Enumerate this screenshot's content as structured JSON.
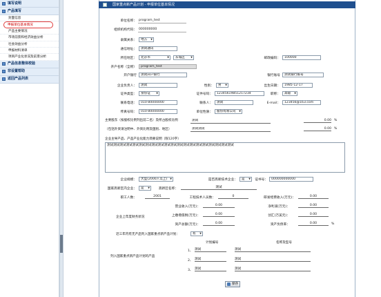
{
  "sidebar": {
    "sections": [
      {
        "label": "填写说明"
      },
      {
        "label": "产品填写",
        "items": [
          "封面信息",
          "申报单位基本情况",
          "产品主要情况",
          "市场前景和经济效益分析",
          "社会效益分析",
          "申报材料清单",
          "项目产业化状况及前景分析"
        ]
      },
      {
        "label": "产品信息整体校验"
      },
      {
        "label": "非设置帮助"
      },
      {
        "label": "返回产品列表"
      }
    ]
  },
  "window": {
    "title": "国家重点新产品计划 - 申报单位基本情况"
  },
  "form": {
    "unit_name": {
      "label": "单位名称：",
      "value": "program_test"
    },
    "org_code": {
      "label": "组织机构代码：",
      "value": "000000000"
    },
    "affiliation": {
      "label": "隶属关系：",
      "value": "地方"
    },
    "address": {
      "label": "通信地址：",
      "value": "测试通讯"
    },
    "region": {
      "label": "所在地区：",
      "province": "北京市",
      "district": "东城区"
    },
    "postcode": {
      "label": "邮政编码：",
      "value": "100000"
    },
    "owner_name": {
      "label": "开户名称（全称）",
      "value": "program_test"
    },
    "bank": {
      "label": "开户银行",
      "value": "测试开户银行"
    },
    "account": {
      "label": "银行账号",
      "value": "测试银行账号"
    },
    "legal_rep": {
      "label": "企业负责人：",
      "value": "测试"
    },
    "gender": {
      "label": "性别：",
      "value": "男"
    },
    "birth": {
      "label": "出生日期：",
      "value": "1985-12-17"
    },
    "cert_type": {
      "label": "证件类型：",
      "value": "身份证"
    },
    "cert_no": {
      "label": "证件号码：",
      "value": "12345619851217234"
    },
    "title": {
      "label": "职称：",
      "value": "高级"
    },
    "phone": {
      "label": "联系电话：",
      "value": "010-80000000"
    },
    "contact": {
      "label": "联系人：",
      "value": "测试"
    },
    "email": {
      "label": "E-mail：",
      "value": "123456@163.com"
    },
    "fax": {
      "label": "传真号码：",
      "value": "010-80000000"
    },
    "unit_nature": {
      "label": "单位性质：",
      "value": "股份有限公司"
    },
    "shareholders": {
      "label1": "主要股东（按股权比例列出前二名）及所占股权比例",
      "label2": "（包括外资请注明中、外资比例及国别、地区）",
      "rows": [
        {
          "name": "测试",
          "pct": "0.00"
        },
        {
          "name": "测试测试",
          "pct": "0.00"
        }
      ],
      "unit": "%"
    },
    "intro_label": "企业主导产品、产品产业化能力简要说明（限120字）",
    "intro_value": "测试测试测试测试测试测试测试测试测试测试测试测试测试测试测试测试测试测试测试测试",
    "scale": {
      "label": "企业规模：",
      "value": "大型(2000人以上)"
    },
    "hightech": {
      "label": "是否高新技术企业：",
      "value": "是"
    },
    "cert_no2": {
      "label": "证书号：",
      "value": "000000000000"
    },
    "national_ind": {
      "label": "国家高新区内企业：",
      "value": "是"
    },
    "zone_name": {
      "label": "高新区名称：",
      "value": "测试"
    },
    "staff": {
      "label": "职工人数：",
      "value": "2001"
    },
    "tech_staff": {
      "label": "工程技术人员数：",
      "value": "0"
    },
    "rd_ratio": {
      "label": "研发经费收入(万元)：",
      "value": "0.00"
    },
    "finance_label": "企业上年度财务状况",
    "revenue": {
      "label": "营业收入(万元)：",
      "value": "0.00"
    },
    "net_profit": {
      "label": "净利润(万元)：",
      "value": "0.00"
    },
    "tax": {
      "label": "上缴增值税(万元)：",
      "value": "0.00"
    },
    "export": {
      "label": "创汇(万美元)：",
      "value": "0.00"
    },
    "assets": {
      "label": "资产总额(万元)：",
      "value": "0.00"
    },
    "debt_ratio": {
      "label": "资产负债率：",
      "value": "0.00",
      "unit": "%"
    },
    "prior_label": "近三年内有无产品列入国家重点新产品计划：",
    "prior_value": "有",
    "plan_label": "列入国家重点新产品计划的产品",
    "plan_headers": {
      "no": "计划编号",
      "name": "名称及型号"
    },
    "plan_rows": [
      {
        "idx": "1、",
        "no": "测试",
        "name": "测试"
      },
      {
        "idx": "2、",
        "no": "测试",
        "name": "测试"
      },
      {
        "idx": "3、",
        "no": "测试",
        "name": "测试"
      }
    ],
    "save_label": "保存"
  }
}
